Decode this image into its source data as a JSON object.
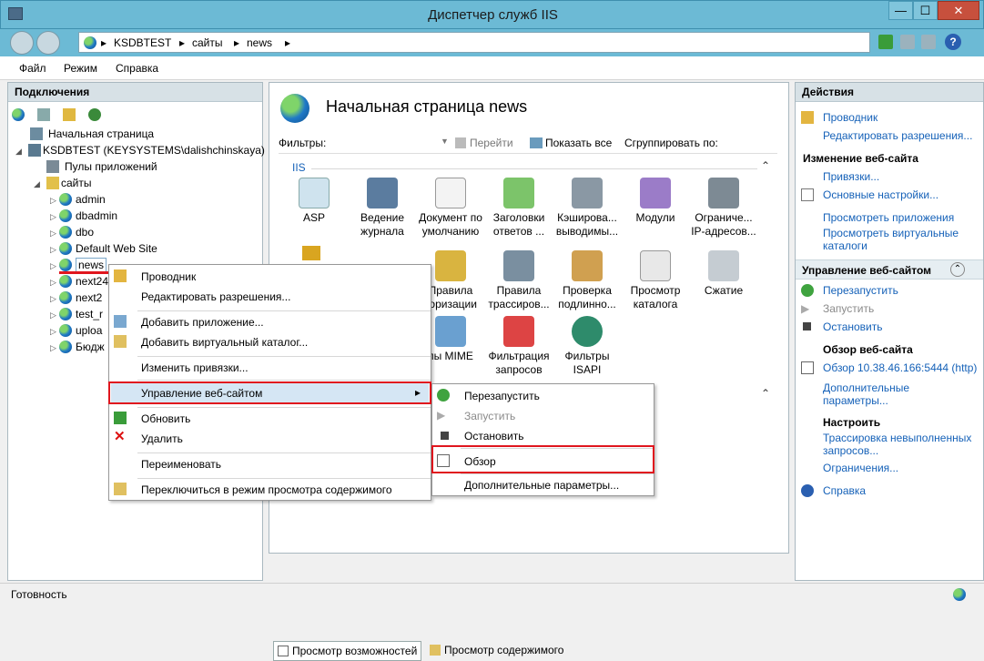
{
  "window": {
    "title": "Диспетчер служб IIS",
    "minimize": "—",
    "maximize": "☐",
    "close": "✕"
  },
  "address": {
    "crumbs": [
      "KSDBTEST",
      "сайты",
      "news"
    ],
    "sep": "▸",
    "help": "?"
  },
  "menu": {
    "items": [
      "Файл",
      "Режим",
      "Справка"
    ]
  },
  "connections": {
    "title": "Подключения",
    "tree": [
      {
        "label": "Начальная страница"
      },
      {
        "label": "KSDBTEST (KEYSYSTEMS\\dalishchinskaya)"
      },
      {
        "label": "Пулы приложений"
      },
      {
        "label": "сайты"
      },
      {
        "label": "admin"
      },
      {
        "label": "dbadmin"
      },
      {
        "label": "dbo"
      },
      {
        "label": "Default Web Site"
      },
      {
        "label": "news"
      },
      {
        "label": "next24"
      },
      {
        "label": "next2"
      },
      {
        "label": "test_r"
      },
      {
        "label": "uploa"
      },
      {
        "label": "Бюдж"
      }
    ]
  },
  "center": {
    "heading": "Начальная страница news",
    "filters_label": "Фильтры:",
    "goto": "Перейти",
    "show_all": "Показать все",
    "group_by": "Сгруппировать по:",
    "group": "IIS",
    "features": [
      {
        "label": "ASP"
      },
      {
        "label": "Ведение журнала"
      },
      {
        "label": "Документ по умолчанию"
      },
      {
        "label": "Заголовки ответов ..."
      },
      {
        "label": "Кэширова... выводимы..."
      },
      {
        "label": "Модули"
      },
      {
        "label": "Ограниче... IP-адресов..."
      },
      {
        "label": "Правила торизации"
      },
      {
        "label": "Правила трассиров..."
      },
      {
        "label": "Проверка подлинно..."
      },
      {
        "label": "Просмотр каталога"
      },
      {
        "label": "Сжатие"
      },
      {
        "label": "пы MIME"
      },
      {
        "label": "Фильтрация запросов"
      },
      {
        "label": "Фильтры ISAPI"
      }
    ],
    "tab_features": "Просмотр возможностей",
    "tab_content": "Просмотр содержимого"
  },
  "actions": {
    "title": "Действия",
    "explorer": "Проводник",
    "edit_perms": "Редактировать разрешения...",
    "edit_site": "Изменение веб-сайта",
    "bindings": "Привязки...",
    "basic": "Основные настройки...",
    "view_apps": "Просмотреть приложения",
    "view_vdirs": "Просмотреть виртуальные каталоги",
    "manage": "Управление веб-сайтом",
    "restart": "Перезапустить",
    "start": "Запустить",
    "stop": "Остановить",
    "browse_site": "Обзор веб-сайта",
    "browse_url": "Обзор 10.38.46.166:5444 (http)",
    "advanced": "Дополнительные параметры...",
    "configure": "Настроить",
    "trace": "Трассировка невыполненных запросов...",
    "limits": "Ограничения...",
    "help": "Справка"
  },
  "context_menu": {
    "items": [
      "Проводник",
      "Редактировать разрешения...",
      "Добавить приложение...",
      "Добавить виртуальный каталог...",
      "Изменить привязки...",
      "Управление веб-сайтом",
      "Обновить",
      "Удалить",
      "Переименовать",
      "Переключиться в режим просмотра содержимого"
    ],
    "arrow": "▸"
  },
  "submenu": {
    "items": [
      "Перезапустить",
      "Запустить",
      "Остановить",
      "Обзор",
      "Дополнительные параметры..."
    ]
  },
  "status": {
    "text": "Готовность"
  }
}
